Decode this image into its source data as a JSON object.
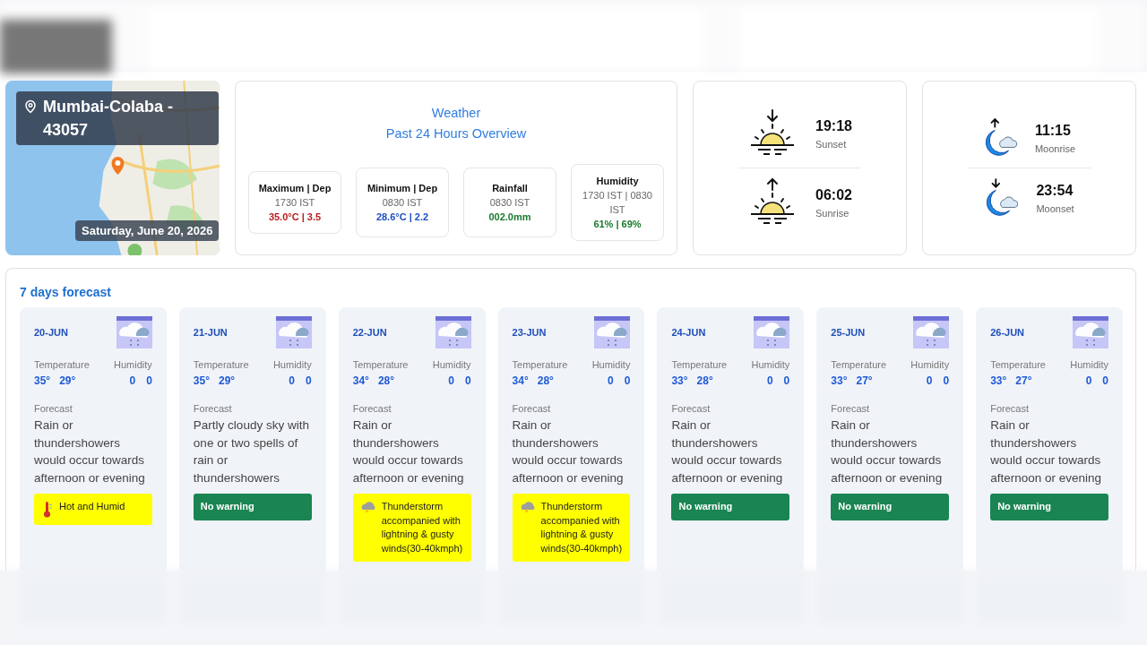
{
  "location": {
    "name": "Mumbai-Colaba - 43057",
    "date": "Saturday, June 20, 2026"
  },
  "overview": {
    "title": "Weather",
    "subtitle": "Past 24 Hours Overview",
    "stats": [
      {
        "label": "Maximum | Dep",
        "time": "1730 IST",
        "value": "35.0°C | 3.5",
        "color": "#b71c1c"
      },
      {
        "label": "Minimum | Dep",
        "time": "0830 IST",
        "value": "28.6°C | 2.2",
        "color": "#1e4fc2"
      },
      {
        "label": "Rainfall",
        "time": "0830 IST",
        "value": "002.0mm",
        "color": "#1b7a2e"
      },
      {
        "label": "Humidity",
        "time": "1730 IST | 0830 IST",
        "value": "61% | 69%",
        "color": "#1b7a2e"
      }
    ]
  },
  "sun": [
    {
      "kind": "set",
      "time": "19:18",
      "label": "Sunset"
    },
    {
      "kind": "rise",
      "time": "06:02",
      "label": "Sunrise"
    }
  ],
  "moon": [
    {
      "kind": "rise",
      "time": "11:15",
      "label": "Moonrise"
    },
    {
      "kind": "set",
      "time": "23:54",
      "label": "Moonset"
    }
  ],
  "forecast": {
    "title": "7 days forecast",
    "days": [
      {
        "date": "20-JUN",
        "temperature_label": "Temperature",
        "humidity_label": "Humidity",
        "max": "35°",
        "min": "29°",
        "humidity": [
          "0",
          "0"
        ],
        "forecast_label": "Forecast",
        "text": "Rain or thundershowers would occur towards afternoon or evening",
        "warning": {
          "kind": "heat",
          "text": "Hot and Humid"
        }
      },
      {
        "date": "21-JUN",
        "temperature_label": "Temperature",
        "humidity_label": "Humidity",
        "max": "35°",
        "min": "29°",
        "humidity": [
          "0",
          "0"
        ],
        "forecast_label": "Forecast",
        "text": "Partly cloudy sky with one or two spells of rain or thundershowers",
        "warning": {
          "kind": "none",
          "text": "No warning"
        }
      },
      {
        "date": "22-JUN",
        "temperature_label": "Temperature",
        "humidity_label": "Humidity",
        "max": "34°",
        "min": "28°",
        "humidity": [
          "0",
          "0"
        ],
        "forecast_label": "Forecast",
        "text": "Rain or thundershowers would occur towards afternoon or evening",
        "warning": {
          "kind": "thunderstorm",
          "text": "Thunderstorm accompanied with lightning & gusty winds(30-40kmph)"
        }
      },
      {
        "date": "23-JUN",
        "temperature_label": "Temperature",
        "humidity_label": "Humidity",
        "max": "34°",
        "min": "28°",
        "humidity": [
          "0",
          "0"
        ],
        "forecast_label": "Forecast",
        "text": "Rain or thundershowers would occur towards afternoon or evening",
        "warning": {
          "kind": "thunderstorm",
          "text": "Thunderstorm accompanied with lightning & gusty winds(30-40kmph)"
        }
      },
      {
        "date": "24-JUN",
        "temperature_label": "Temperature",
        "humidity_label": "Humidity",
        "max": "33°",
        "min": "28°",
        "humidity": [
          "0",
          "0"
        ],
        "forecast_label": "Forecast",
        "text": "Rain or thundershowers would occur towards afternoon or evening",
        "warning": {
          "kind": "none",
          "text": "No warning"
        }
      },
      {
        "date": "25-JUN",
        "temperature_label": "Temperature",
        "humidity_label": "Humidity",
        "max": "33°",
        "min": "27°",
        "humidity": [
          "0",
          "0"
        ],
        "forecast_label": "Forecast",
        "text": "Rain or thundershowers would occur towards afternoon or evening",
        "warning": {
          "kind": "none",
          "text": "No warning"
        }
      },
      {
        "date": "26-JUN",
        "temperature_label": "Temperature",
        "humidity_label": "Humidity",
        "max": "33°",
        "min": "27°",
        "humidity": [
          "0",
          "0"
        ],
        "forecast_label": "Forecast",
        "text": "Rain or thundershowers would occur towards afternoon or evening",
        "warning": {
          "kind": "none",
          "text": "No warning"
        }
      }
    ]
  }
}
